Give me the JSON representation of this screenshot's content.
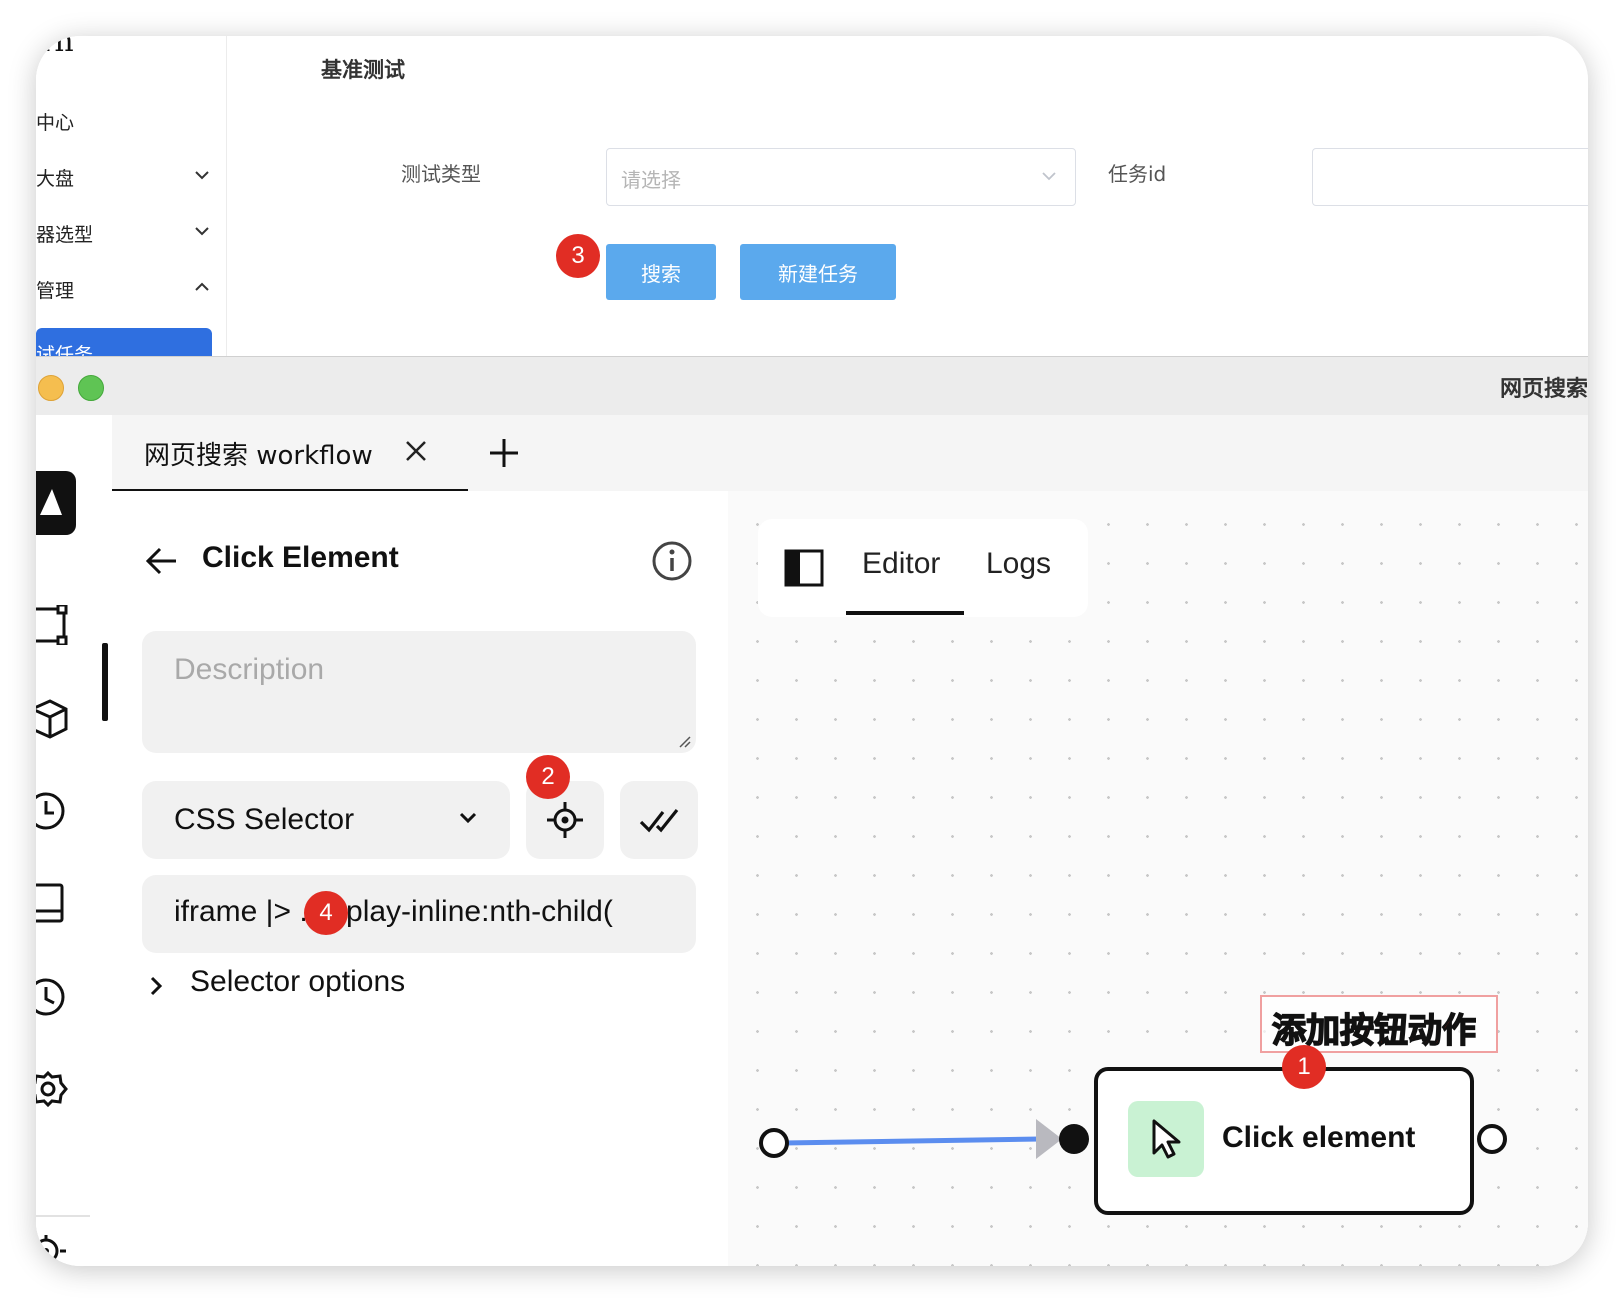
{
  "back_window": {
    "logo_fragment": "rn",
    "sidebar": {
      "items": [
        {
          "label": "中心"
        },
        {
          "label": "大盘"
        },
        {
          "label": "器选型"
        },
        {
          "label": "管理"
        }
      ],
      "active_item": "试任务"
    },
    "page_title": "基准测试",
    "form": {
      "test_type_label": "测试类型",
      "test_type_placeholder": "请选择",
      "task_id_label": "任务id",
      "task_id_value": ""
    },
    "buttons": {
      "search": "搜索",
      "new_task": "新建任务"
    }
  },
  "front_window": {
    "title": "网页搜索",
    "tabs": [
      {
        "label": "网页搜索 workflow"
      }
    ],
    "rail_icons": [
      "app-logo-icon",
      "workflow-icon",
      "package-icon",
      "clock-icon",
      "device-icon",
      "history-icon",
      "settings-icon",
      "target-icon"
    ],
    "panel": {
      "title": "Click Element",
      "description_placeholder": "Description",
      "selector_type": "CSS Selector",
      "selector_value": "iframe |> .display-inline:nth-child(",
      "selector_options": "Selector options"
    },
    "canvas": {
      "tabs": [
        "Editor",
        "Logs"
      ],
      "active_tab": "Editor",
      "node_label": "Click element",
      "annotation": "添加按钮动作"
    }
  },
  "badges": [
    "1",
    "2",
    "3",
    "4"
  ],
  "colors": {
    "primary_blue": "#5ba9ed",
    "active_menu": "#2f6fe0",
    "badge_red": "#e12d24",
    "edge_blue": "#5b8def",
    "node_icon_bg": "#c9f2d3"
  }
}
